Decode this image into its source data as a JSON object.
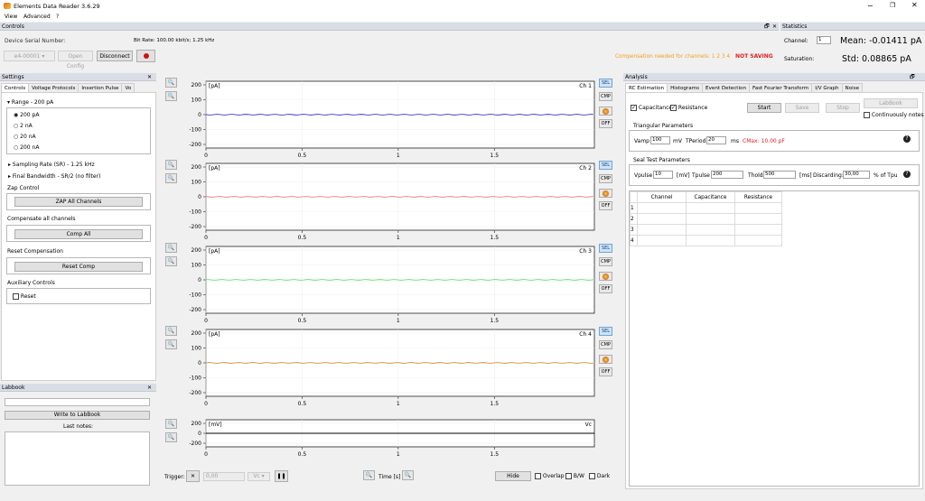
{
  "app": {
    "title": "Elements Data Reader 3.6.29",
    "menu": [
      "View",
      "Advanced",
      "?"
    ]
  },
  "controls": {
    "header": "Controls",
    "serial_label": "Device Serial Number:",
    "serial_value": "e4-00001",
    "open_config": "Open Config",
    "disconnect": "Disconnect",
    "bitrate": "Bit Rate: 100.00 kbit/s; 1.25 kHz",
    "warning": "Compensation needed for channels: 1 2 3 4",
    "not_saving": "NOT SAVING"
  },
  "statistics": {
    "header": "Statistics",
    "channel_label": "Channel:",
    "channel_value": "1",
    "mean": "Mean: -0.01411 pA",
    "saturation_label": "Saturation:",
    "std": "Std: 0.08865 pA"
  },
  "settings": {
    "header": "Settings",
    "tabs": [
      "Controls",
      "Voltage Protocols",
      "Insertion Pulse",
      "Vo"
    ],
    "range_title": "Range - 200 pA",
    "ranges": [
      "200 pA",
      "2 nA",
      "20 nA",
      "200 nA"
    ],
    "sampling": "Sampling Rate (SR) - 1.25 kHz",
    "bandwidth": "Final Bandwidth - SR/2 (no filter)",
    "zap_title": "Zap Control",
    "zap_btn": "ZAP All Channels",
    "comp_title": "Compensate all channels",
    "comp_btn": "Comp All",
    "reset_title": "Reset Compensation",
    "reset_btn": "Reset Comp",
    "aux_title": "Auxiliary Controls",
    "aux_reset": "Reset"
  },
  "labbook": {
    "header": "Labbook",
    "write_btn": "Write to LabBook",
    "last_notes": "Last notes:"
  },
  "plots": [
    {
      "unit": "[pA]",
      "name": "Ch 1",
      "color": "#3a3ad0",
      "ticks": [
        "200",
        "100",
        "0",
        "-100",
        "-200"
      ]
    },
    {
      "unit": "[pA]",
      "name": "Ch 2",
      "color": "#f08080",
      "ticks": [
        "200",
        "100",
        "0",
        "-100",
        "-200"
      ]
    },
    {
      "unit": "[pA]",
      "name": "Ch 3",
      "color": "#6ce06c",
      "ticks": [
        "200",
        "100",
        "0",
        "-100",
        "-200"
      ]
    },
    {
      "unit": "[pA]",
      "name": "Ch 4",
      "color": "#d89040",
      "ticks": [
        "200",
        "100",
        "0",
        "-100",
        "-200"
      ]
    }
  ],
  "vc_plot": {
    "unit": "[mV]",
    "name": "Vc",
    "ticks": [
      "200",
      "0",
      "-200"
    ]
  },
  "xticks": [
    "0",
    "0.5",
    "1",
    "1.5"
  ],
  "side_buttons": [
    "SEL",
    "CMP",
    "OFF"
  ],
  "bottom": {
    "trigger": "Trigger:",
    "trigger_value": "0,00",
    "trigger_unit": "Vc",
    "time": "Time [s]",
    "hide": "Hide",
    "overlap": "Overlap",
    "bw": "B/W",
    "dark": "Dark"
  },
  "analysis": {
    "header": "Analysis",
    "tabs": [
      "RC Estimation",
      "Histograms",
      "Event Detection",
      "Fast Fourier Transform",
      "I/V Graph",
      "Noise"
    ],
    "capacitance": "Capacitance",
    "resistance": "Resistance",
    "start": "Start",
    "save": "Save",
    "stop": "Stop",
    "labbook": "LabBook",
    "cont_notes": "Continuously notes",
    "tri_title": "Triangular Parameters",
    "vamp_label": "Vamp",
    "vamp_value": "100",
    "vamp_unit": "mV",
    "tperiod_label": "TPeriod",
    "tperiod_value": "20",
    "tperiod_unit": "ms",
    "cmax": "CMax: 10.00 pF",
    "seal_title": "Seal Test Parameters",
    "vpulse_label": "Vpulse",
    "vpulse_value": "10",
    "vpulse_unit": "[mV]",
    "tpulse_label": "Tpulse",
    "tpulse_value": "200",
    "thold_label": "Thold",
    "thold_value": "500",
    "thold_unit": "[ms]",
    "discard_label": "Discarding:",
    "discard_value": "30,00",
    "discard_unit": "% of Tpu",
    "table_headers": [
      "Channel",
      "Capacitance",
      "Resistance"
    ],
    "rows": [
      "1",
      "2",
      "3",
      "4"
    ]
  }
}
